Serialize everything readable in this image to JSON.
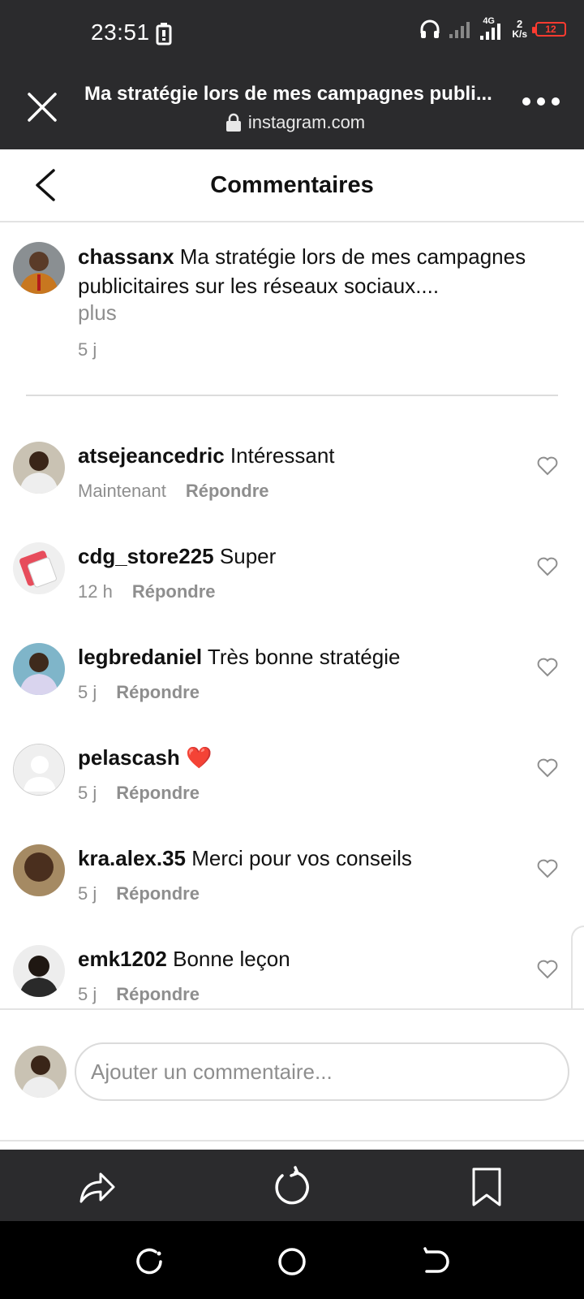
{
  "status_bar": {
    "time": "23:51",
    "network": "4G",
    "speed_value": "2",
    "speed_unit": "K/s",
    "battery": "12"
  },
  "browser": {
    "title": "Ma stratégie lors de mes campagnes publi...",
    "domain": "instagram.com"
  },
  "header": {
    "title": "Commentaires"
  },
  "caption": {
    "username": "chassanx",
    "text": "Ma stratégie lors de mes campagnes publicitaires sur les réseaux sociaux....",
    "more": "plus",
    "time": "5 j"
  },
  "comments": [
    {
      "username": "atsejeancedric",
      "text": "Intéressant",
      "time": "Maintenant",
      "reply": "Répondre"
    },
    {
      "username": "cdg_store225",
      "text": "Super",
      "time": "12 h",
      "reply": "Répondre"
    },
    {
      "username": "legbredaniel",
      "text": "Très bonne stratégie",
      "time": "5 j",
      "reply": "Répondre"
    },
    {
      "username": "pelascash",
      "text": "❤️",
      "time": "5 j",
      "reply": "Répondre"
    },
    {
      "username": "kra.alex.35",
      "text": "Merci pour vos conseils",
      "time": "5 j",
      "reply": "Répondre"
    },
    {
      "username": "emk1202",
      "text": "Bonne leçon",
      "time": "5 j",
      "reply": "Répondre"
    }
  ],
  "composer": {
    "placeholder": "Ajouter un commentaire..."
  },
  "colors": {
    "dark_bar": "#2b2b2d",
    "muted_text": "#8e8e8e",
    "heart_red": "#e0245e",
    "battery_red": "#ff3b30"
  }
}
